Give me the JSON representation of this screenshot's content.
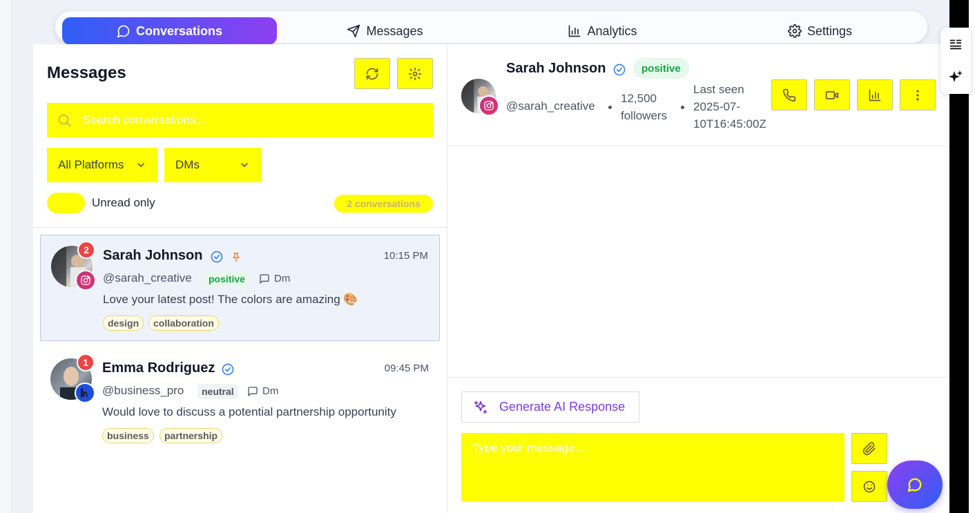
{
  "nav": {
    "tabs": [
      {
        "label": "Conversations",
        "icon": "chat-bubble-icon",
        "active": true
      },
      {
        "label": "Messages",
        "icon": "send-icon",
        "active": false
      },
      {
        "label": "Analytics",
        "icon": "bar-chart-icon",
        "active": false
      },
      {
        "label": "Settings",
        "icon": "gear-icon",
        "active": false
      }
    ]
  },
  "sidebar": {
    "title": "Messages",
    "search_placeholder": "Search conversations...",
    "platform_filter": "All Platforms",
    "type_filter": "DMs",
    "unread_toggle_label": "Unread only",
    "conversation_count": "2 conversations",
    "conversations": [
      {
        "name": "Sarah Johnson",
        "handle": "@sarah_creative",
        "time": "10:15 PM",
        "unread": "2",
        "sentiment": "positive",
        "type": "Dm",
        "preview": "Love your latest post! The colors are amazing 🎨",
        "tags": [
          "design",
          "collaboration"
        ],
        "platform": "instagram",
        "verified": true,
        "pinned": true
      },
      {
        "name": "Emma Rodriguez",
        "handle": "@business_pro",
        "time": "09:45 PM",
        "unread": "1",
        "sentiment": "neutral",
        "type": "Dm",
        "preview": "Would love to discuss a potential partnership opportunity",
        "tags": [
          "business",
          "partnership"
        ],
        "platform": "linkedin",
        "verified": true,
        "pinned": false
      }
    ]
  },
  "chat": {
    "name": "Sarah Johnson",
    "sentiment": "positive",
    "handle": "@sarah_creative",
    "followers_line1": "12,500",
    "followers_line2": "followers",
    "last_seen_line1": "Last seen",
    "last_seen_line2": "2025-07-",
    "last_seen_line3": "10T16:45:00Z",
    "ai_button_label": "Generate AI Response",
    "input_placeholder": "Type your message..."
  },
  "colors": {
    "accent_start": "#2f5ff5",
    "accent_end": "#8d3ff0",
    "highlight": "#ffff00",
    "unread_badge": "#ef4444",
    "positive": "#16a34a",
    "verified": "#3b82f6"
  }
}
